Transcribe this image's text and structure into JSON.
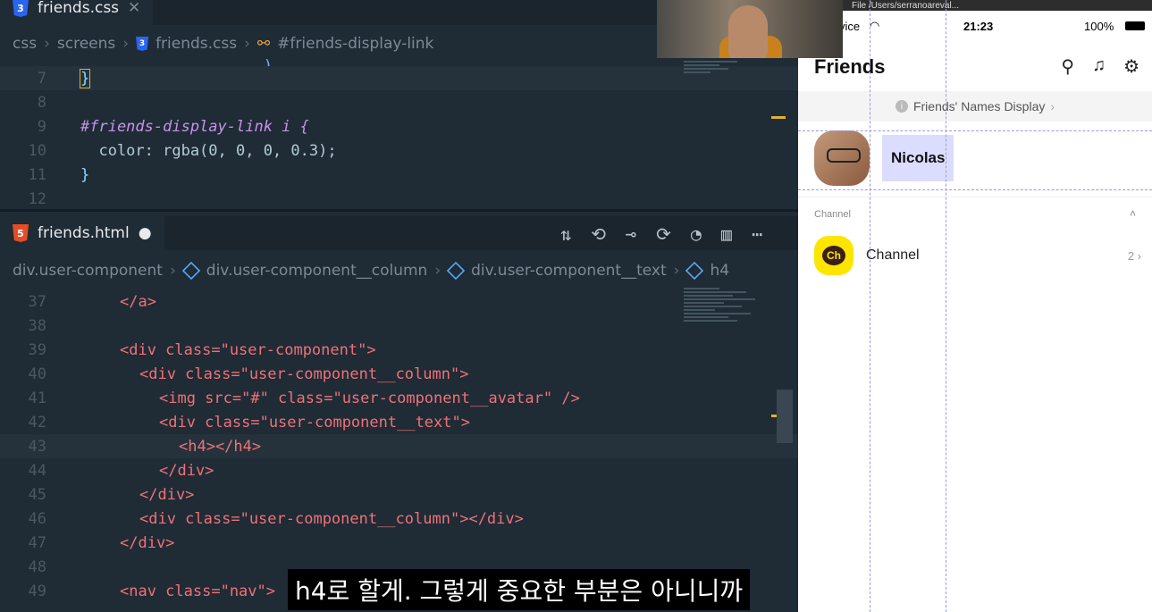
{
  "editor_top": {
    "tab_name": "friends.css",
    "tab_icon": "css-icon",
    "breadcrumb": [
      "css",
      "screens",
      "friends.css",
      "#friends-display-link"
    ],
    "lines": [
      {
        "num": "",
        "code": ""
      },
      {
        "num": "7",
        "code": "}"
      },
      {
        "num": "8",
        "code": ""
      },
      {
        "num": "9",
        "code": "#friends-display-link i {"
      },
      {
        "num": "10",
        "code": "  color: rgba(0, 0, 0, 0.3);"
      },
      {
        "num": "11",
        "code": "}"
      },
      {
        "num": "12",
        "code": ""
      }
    ]
  },
  "editor_bottom": {
    "tab_name": "friends.html",
    "tab_icon": "html-icon",
    "modified_dot": "●",
    "toolbar_icons": [
      "git-compare-icon",
      "go-back-icon",
      "commit-icon",
      "go-forward-icon",
      "git-lens-icon",
      "split-editor-icon",
      "more-icon"
    ],
    "toolbar_glyphs": [
      "⇅",
      "⟲",
      "⊸",
      "⟳",
      "◔",
      "▥",
      "⋯"
    ],
    "breadcrumb": [
      "div.user-component",
      "div.user-component__column",
      "div.user-component__text",
      "h4"
    ],
    "lines": [
      {
        "num": "37",
        "code": "</a>"
      },
      {
        "num": "38",
        "code": ""
      },
      {
        "num": "39",
        "code": "<div class=\"user-component\">"
      },
      {
        "num": "40",
        "code": "<div class=\"user-component__column\">"
      },
      {
        "num": "41",
        "code": "<img src=\"#\" class=\"user-component__avatar\" />"
      },
      {
        "num": "42",
        "code": "<div class=\"user-component__text\">"
      },
      {
        "num": "43",
        "code": "<h4></h4>"
      },
      {
        "num": "44",
        "code": "</div>"
      },
      {
        "num": "45",
        "code": "</div>"
      },
      {
        "num": "46",
        "code": "<div class=\"user-component__column\"></div>"
      },
      {
        "num": "47",
        "code": "</div>"
      },
      {
        "num": "48",
        "code": ""
      },
      {
        "num": "49",
        "code": "<nav class=\"nav\">"
      }
    ]
  },
  "simulator": {
    "chrome_text": "File  /Users/serranoareval...",
    "status_carrier": "vice",
    "status_time": "21:23",
    "status_battery": "100%",
    "title": "Friends",
    "top_icons": [
      "search-icon",
      "music-icon",
      "settings-icon"
    ],
    "top_glyphs": [
      "⚲",
      "♫",
      "⚙"
    ],
    "banner_text": "Friends' Names Display",
    "banner_chevron": "›",
    "user_name": "Nicolas",
    "section_label": "Channel",
    "section_chevron": "˄",
    "channel_logo": "Ch",
    "channel_name": "Channel",
    "channel_count": "2 ›"
  },
  "subtitle": "h4로 할게. 그렇게 중요한 부분은 아니니까",
  "colors": {
    "editor_bg": "#1f2b35",
    "tag": "#f07178",
    "attr": "#c792ea",
    "string": "#c3e88d",
    "number": "#f78c6c",
    "kakao_yellow": "#fee500"
  }
}
